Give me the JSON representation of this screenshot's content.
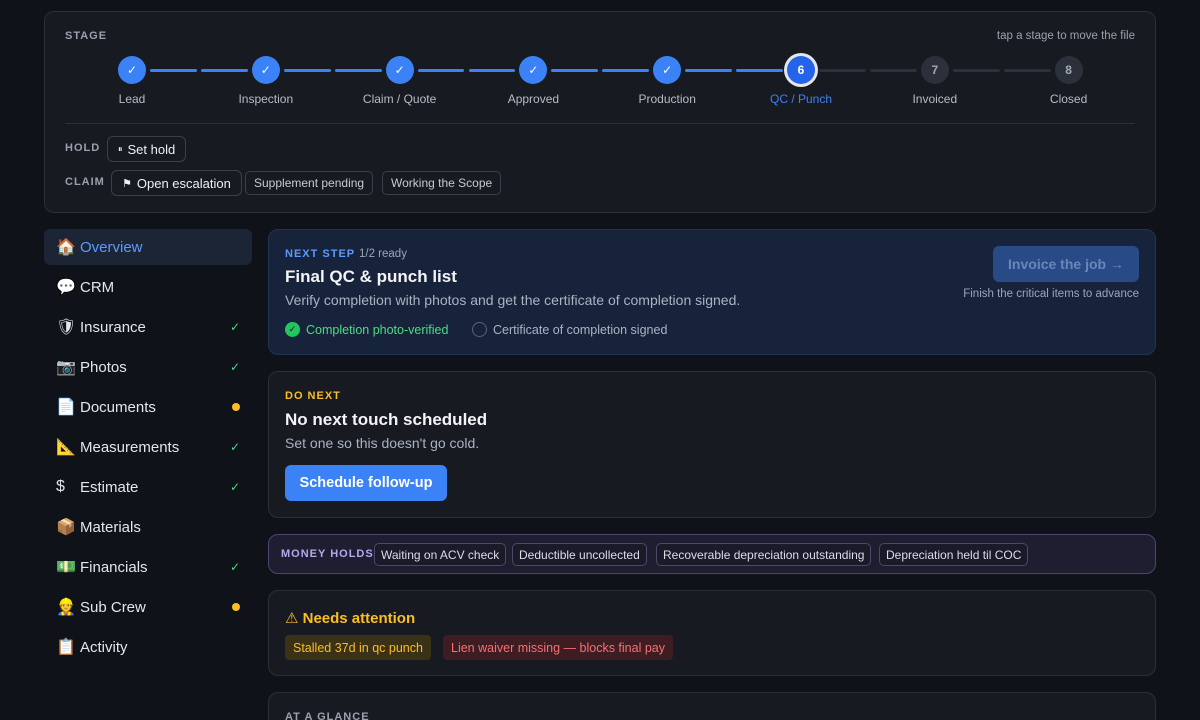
{
  "stage_card": {
    "label": "STAGE",
    "hint": "tap a stage to move the file",
    "stages": [
      {
        "label": "Lead",
        "number": "✓",
        "status": "done"
      },
      {
        "label": "Inspection",
        "number": "✓",
        "status": "done"
      },
      {
        "label": "Claim / Quote",
        "number": "✓",
        "status": "done"
      },
      {
        "label": "Approved",
        "number": "✓",
        "status": "done"
      },
      {
        "label": "Production",
        "number": "✓",
        "status": "done"
      },
      {
        "label": "QC / Punch",
        "number": "6",
        "status": "current"
      },
      {
        "label": "Invoiced",
        "number": "7",
        "status": "todo"
      },
      {
        "label": "Closed",
        "number": "8",
        "status": "todo"
      }
    ],
    "hold_label": "HOLD",
    "set_hold_icon": "pause-icon",
    "set_hold_glyph": "⏸",
    "set_hold_label": "Set hold",
    "claim_label": "CLAIM",
    "escalation_icon": "flag-icon",
    "escalation_glyph": "⚑",
    "escalation_label": "Open escalation",
    "claim_tags": [
      "Supplement pending",
      "Working the Scope"
    ]
  },
  "sidebar": {
    "items": [
      {
        "icon": "🏠",
        "icon_name": "house-icon",
        "label": "Overview",
        "active": true,
        "mark": "none"
      },
      {
        "icon": "💬",
        "icon_name": "speech-bubble-icon",
        "label": "CRM",
        "mark": "none"
      },
      {
        "icon": "🛡",
        "icon_name": "shield-icon",
        "label": "Insurance",
        "mark": "check"
      },
      {
        "icon": "📷",
        "icon_name": "camera-icon",
        "label": "Photos",
        "mark": "check"
      },
      {
        "icon": "📄",
        "icon_name": "document-icon",
        "label": "Documents",
        "mark": "dot"
      },
      {
        "icon": "📐",
        "icon_name": "ruler-icon",
        "label": "Measurements",
        "mark": "check"
      },
      {
        "icon": "$",
        "icon_name": "dollar-icon",
        "label": "Estimate",
        "mark": "check"
      },
      {
        "icon": "📦",
        "icon_name": "package-icon",
        "label": "Materials",
        "mark": "none"
      },
      {
        "icon": "💵",
        "icon_name": "money-icon",
        "label": "Financials",
        "mark": "check"
      },
      {
        "icon": "👷",
        "icon_name": "worker-icon",
        "label": "Sub Crew",
        "mark": "dot"
      },
      {
        "icon": "📋",
        "icon_name": "clipboard-icon",
        "label": "Activity",
        "mark": "none"
      }
    ],
    "check_glyph": "✓"
  },
  "next_step": {
    "kicker": "NEXT STEP",
    "ready": "1/2 ready",
    "title": "Final QC & punch list",
    "description": "Verify completion with photos and get the certificate of completion signed.",
    "items": [
      {
        "label": "Completion photo-verified",
        "done": true
      },
      {
        "label": "Certificate of completion signed",
        "done": false
      }
    ],
    "button_label": "Invoice the job →",
    "button_hint": "Finish the critical items to advance"
  },
  "do_next": {
    "kicker": "DO NEXT",
    "title": "No next touch scheduled",
    "description": "Set one so this doesn't go cold.",
    "button_label": "Schedule follow-up"
  },
  "money_holds": {
    "label": "MONEY HOLDS",
    "chips": [
      "Waiting on ACV check",
      "Deductible uncollected",
      "Recoverable depreciation outstanding",
      "Depreciation held til COC"
    ]
  },
  "attention": {
    "title": "⚠ Needs attention",
    "chips": [
      "Stalled 37d in qc punch",
      "Lien waiver missing — blocks final pay"
    ]
  },
  "glance": {
    "label": "AT A GLANCE"
  },
  "colors": {
    "accent": "#3b82f6",
    "success": "#22c55e",
    "warning": "#fbbf24",
    "danger": "#f87171"
  }
}
